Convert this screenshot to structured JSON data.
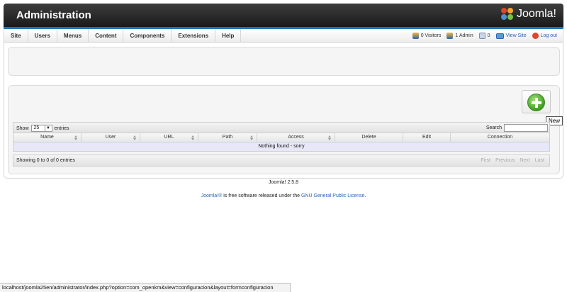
{
  "header": {
    "title": "Administration",
    "brand": "Joomla!"
  },
  "menu": {
    "items": [
      "Site",
      "Users",
      "Menus",
      "Content",
      "Components",
      "Extensions",
      "Help"
    ]
  },
  "status": {
    "visitors": "0 Visitors",
    "admins": "1 Admin",
    "messages": "0",
    "view_site": "View Site",
    "logout": "Log out"
  },
  "toolbar": {
    "new_tooltip": "New"
  },
  "table": {
    "show_label": "Show",
    "entries_value": "25",
    "entries_label": "entries",
    "search_label": "Search",
    "search_value": "",
    "columns": [
      "Name",
      "User",
      "URL",
      "Path",
      "Access",
      "Delete",
      "Edit",
      "Connection"
    ],
    "empty_message": "Nothing found - sorry",
    "info": "Showing 0 to 0 of 0 entries",
    "pager": [
      "First",
      "Previous",
      "Next",
      "Last"
    ]
  },
  "footer": {
    "version": "Joomla! 2.5.8",
    "license_link": "Joomla!®",
    "license_text": " is free software released under the ",
    "gpl_link": "GNU General Public License",
    "gpl_end": "."
  },
  "browser_status": {
    "url": "localhost/joomla25en/administrator/index.php?option=com_openkm&view=configuracion&layout=formconfiguracion"
  },
  "colors": {
    "header_bg": "#1a1a1a",
    "accent_blue": "#1d74c0",
    "link": "#2a63b3",
    "new_green": "#3f9f1f",
    "empty_row": "#e6e8f8"
  }
}
